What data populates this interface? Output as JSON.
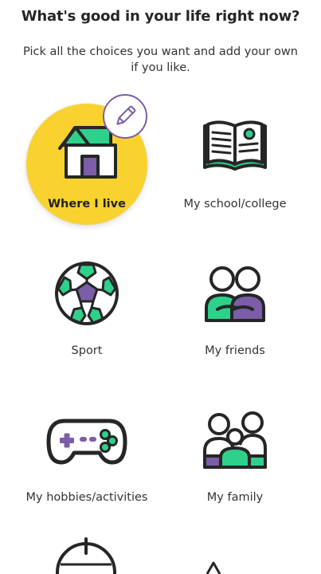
{
  "header": {
    "title": "What's good in your life right now?",
    "subtitle": "Pick all the choices you want and add your own if you like."
  },
  "choices": [
    {
      "label": "Where I live",
      "icon": "house-icon",
      "selected": true
    },
    {
      "label": "My school/college",
      "icon": "open-book-icon",
      "selected": false
    },
    {
      "label": "Sport",
      "icon": "football-icon",
      "selected": false
    },
    {
      "label": "My friends",
      "icon": "friends-icon",
      "selected": false
    },
    {
      "label": "My hobbies/activities",
      "icon": "game-controller-icon",
      "selected": false
    },
    {
      "label": "My family",
      "icon": "family-icon",
      "selected": false
    }
  ],
  "edit_badge": {
    "icon": "pencil-icon"
  },
  "colors": {
    "selected_bg": "#f9d22f",
    "accent_green": "#2ed18b",
    "accent_purple": "#7b5ea7",
    "outline": "#262626"
  }
}
